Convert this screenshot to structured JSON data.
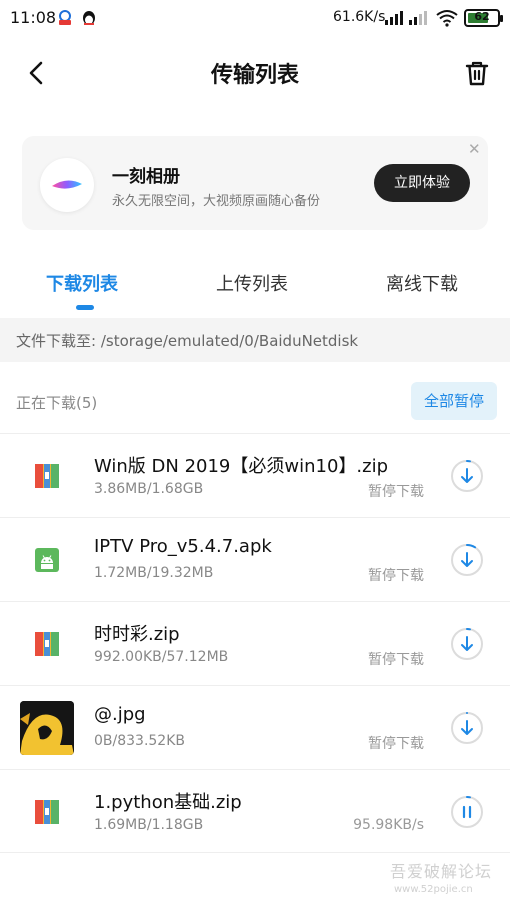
{
  "status_bar": {
    "time": "11:08",
    "net_speed": "61.6K/s",
    "battery": "62"
  },
  "header": {
    "title": "传输列表"
  },
  "banner": {
    "title": "一刻相册",
    "subtitle": "永久无限空间，大视频原画随心备份",
    "button": "立即体验"
  },
  "tabs": [
    {
      "label": "下载列表",
      "active": true
    },
    {
      "label": "上传列表",
      "active": false
    },
    {
      "label": "离线下载",
      "active": false
    }
  ],
  "path": {
    "text": "文件下载至: /storage/emulated/0/BaiduNetdisk"
  },
  "section": {
    "label": "正在下载(5)",
    "pause_all": "全部暂停"
  },
  "downloads": [
    {
      "name": "Win版 DN 2019【必须win10】.zip",
      "size": "3.86MB/1.68GB",
      "status": "暂停下载",
      "icon": "zip-icon",
      "action": "download-icon",
      "progress": 0.002
    },
    {
      "name": "IPTV Pro_v5.4.7.apk",
      "size": "1.72MB/19.32MB",
      "status": "暂停下载",
      "icon": "android-apk-icon",
      "action": "download-icon",
      "progress": 0.09
    },
    {
      "name": "时时彩.zip",
      "size": "992.00KB/57.12MB",
      "status": "暂停下载",
      "icon": "zip-icon",
      "action": "download-icon",
      "progress": 0.017
    },
    {
      "name": "@.jpg",
      "size": "0B/833.52KB",
      "status": "暂停下载",
      "icon": "image-thumbnail",
      "action": "download-icon",
      "progress": 0
    },
    {
      "name": "1.python基础.zip",
      "size": "1.69MB/1.18GB",
      "status": "95.98KB/s",
      "icon": "zip-icon",
      "action": "pause-icon",
      "progress": 0.0014
    }
  ],
  "watermark": {
    "main": "吾爱破解论坛",
    "sub": "www.52pojie.cn"
  },
  "colors": {
    "accent": "#1e88e5",
    "pause_all_bg": "#e3f2fa",
    "banner_button": "#222222"
  }
}
